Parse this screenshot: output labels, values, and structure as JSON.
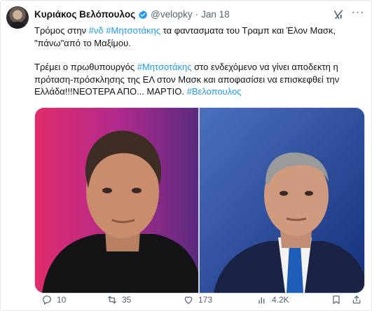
{
  "tweet": {
    "author_name": "Κυριάκος Βελόπουλος",
    "handle": "@velopky",
    "separator": "·",
    "date": "Jan 18",
    "more_label": "···",
    "p1": {
      "t1": "Τρόμος στην ",
      "h1": "#νδ",
      "t2": " ",
      "h2": "#Μητσοτάκης",
      "t3": "  τα φαντασματα του Τραμπ και  Έλον Μασκ, \"πάνω\"από το Μαξίμου."
    },
    "p2": {
      "t1": "Τρέμει ο πρωθυπουργός ",
      "h1": "#Μητσοτάκης",
      "t2": " στο ενδεχόμενο να γίνει αποδεκτη η πρόταση-πρόσκλησης της ΕΛ στον Μασκ και αποφασίσει να επισκεφθεί την Ελλάδα!!!ΝΕΟΤΕΡΑ ΑΠΟ... ΜΑΡΤΙΟ. ",
      "h2": "#Βελοπουλος"
    }
  },
  "actions": {
    "replies": "10",
    "reposts": "35",
    "likes": "173",
    "views": "4.2K"
  },
  "icons": {
    "verified": "verified-badge-icon",
    "grok": "grok-icon",
    "more": "more-icon",
    "reply": "reply-icon",
    "repost": "repost-icon",
    "like": "like-icon",
    "views": "views-icon",
    "bookmark": "bookmark-icon",
    "share": "share-icon"
  },
  "colors": {
    "accent": "#1d9bf0",
    "text": "#0f1419",
    "muted": "#536471"
  }
}
